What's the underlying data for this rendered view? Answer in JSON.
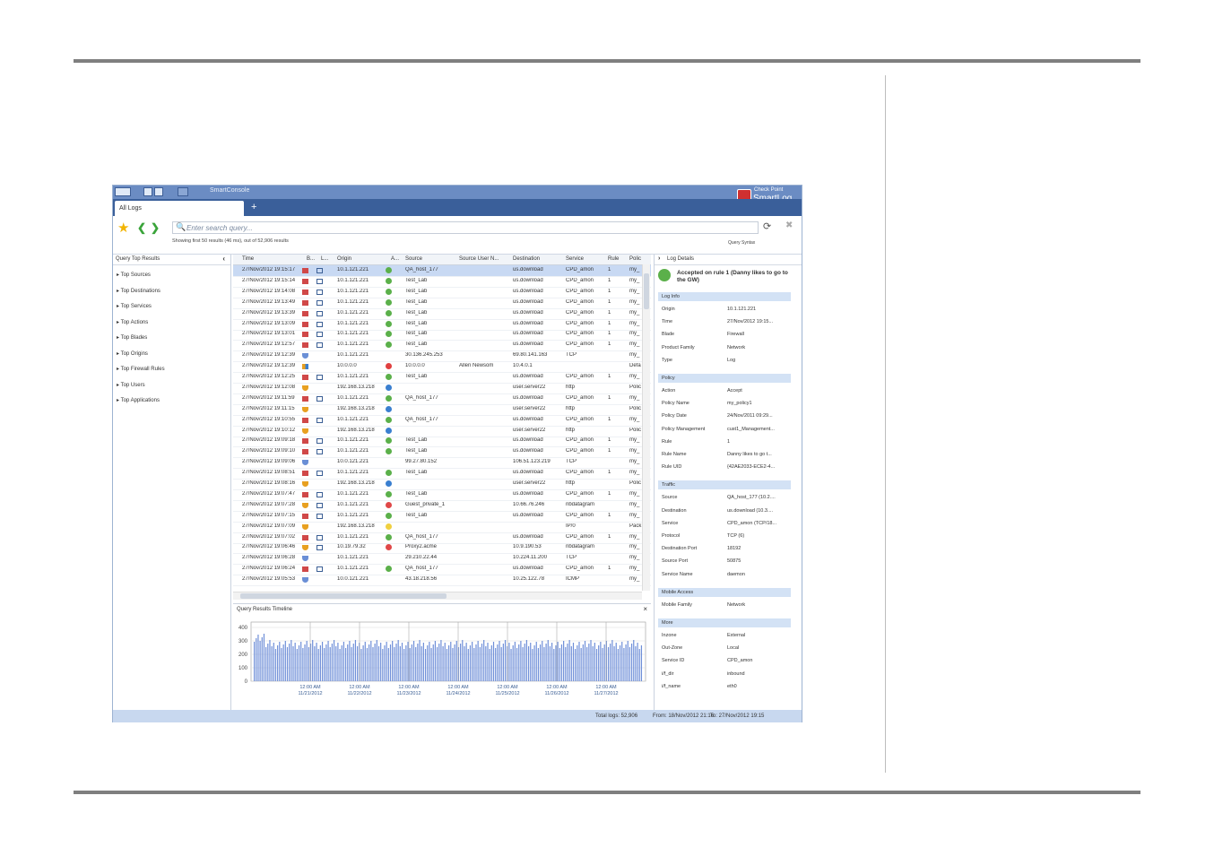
{
  "window": {
    "title_menu": "SmartConsole",
    "brand_line1": "Check Point",
    "brand_line2": "SmartLog"
  },
  "tabs": [
    {
      "label": "All Logs"
    }
  ],
  "tab_add": "+",
  "search": {
    "placeholder": "Enter search query...",
    "showing": "Showing first 50 results (46 ms), out of 52,906 results",
    "syntax": "Query Syntax"
  },
  "left_panel": {
    "title": "Query Top Results",
    "items": [
      "Top Sources",
      "Top Destinations",
      "Top Services",
      "Top Actions",
      "Top Blades",
      "Top Origins",
      "Top Firewall Rules",
      "Top Users",
      "Top Applications"
    ]
  },
  "grid": {
    "columns": [
      "Time",
      "B...",
      "L...",
      "Origin",
      "A...",
      "Source",
      "Source User N...",
      "Destination",
      "Service",
      "Rule",
      "Polic"
    ],
    "rows": [
      {
        "time": "27/Nov/2012 19:15:17",
        "blade": "fw",
        "origin": "10.1.121.221",
        "action": "accept",
        "source": "QA_host_177",
        "user": "",
        "dest": "us.download",
        "service": "CPD_amon",
        "rule": "1",
        "policy": "my_"
      },
      {
        "time": "27/Nov/2012 19:15:14",
        "blade": "fw",
        "origin": "10.1.121.221",
        "action": "accept",
        "source": "Test_Lab",
        "user": "",
        "dest": "us.download",
        "service": "CPD_amon",
        "rule": "1",
        "policy": "my_"
      },
      {
        "time": "27/Nov/2012 19:14:08",
        "blade": "fw",
        "origin": "10.1.121.221",
        "action": "accept",
        "source": "Test_Lab",
        "user": "",
        "dest": "us.download",
        "service": "CPD_amon",
        "rule": "1",
        "policy": "my_"
      },
      {
        "time": "27/Nov/2012 19:13:49",
        "blade": "fw",
        "origin": "10.1.121.221",
        "action": "accept",
        "source": "Test_Lab",
        "user": "",
        "dest": "us.download",
        "service": "CPD_amon",
        "rule": "1",
        "policy": "my_"
      },
      {
        "time": "27/Nov/2012 19:13:39",
        "blade": "fw",
        "origin": "10.1.121.221",
        "action": "accept",
        "source": "Test_Lab",
        "user": "",
        "dest": "us.download",
        "service": "CPD_amon",
        "rule": "1",
        "policy": "my_"
      },
      {
        "time": "27/Nov/2012 19:13:09",
        "blade": "fw",
        "origin": "10.1.121.221",
        "action": "accept",
        "source": "Test_Lab",
        "user": "",
        "dest": "us.download",
        "service": "CPD_amon",
        "rule": "1",
        "policy": "my_"
      },
      {
        "time": "27/Nov/2012 19:13:01",
        "blade": "fw",
        "origin": "10.1.121.221",
        "action": "accept",
        "source": "Test_Lab",
        "user": "",
        "dest": "us.download",
        "service": "CPD_amon",
        "rule": "1",
        "policy": "my_"
      },
      {
        "time": "27/Nov/2012 19:12:57",
        "blade": "fw",
        "origin": "10.1.121.221",
        "action": "accept",
        "source": "Test_Lab",
        "user": "",
        "dest": "us.download",
        "service": "CPD_amon",
        "rule": "1",
        "policy": "my_"
      },
      {
        "time": "27/Nov/2012 19:12:39",
        "blade": "ips",
        "origin": "10.1.121.221",
        "action": "",
        "source": "30.136.245.253",
        "user": "",
        "dest": "69.80.141.163",
        "service": "TCP",
        "rule": "",
        "policy": "my_"
      },
      {
        "time": "27/Nov/2012 19:12:39",
        "blade": "multi",
        "origin": "10.0.0.0",
        "action": "drop",
        "source": "10.0.0.0",
        "user": "Allen Newsom",
        "dest": "10.4.0.1",
        "service": "",
        "rule": "",
        "policy": "Defa"
      },
      {
        "time": "27/Nov/2012 19:12:25",
        "blade": "fw",
        "origin": "10.1.121.221",
        "action": "accept",
        "source": "Test_Lab",
        "user": "",
        "dest": "us.download",
        "service": "CPD_amon",
        "rule": "1",
        "policy": "my_"
      },
      {
        "time": "27/Nov/2012 19:12:08",
        "blade": "av",
        "origin": "192.168.13.218",
        "action": "shield",
        "source": "",
        "user": "",
        "dest": "user.server22",
        "service": "http",
        "rule": "",
        "policy": "Polic"
      },
      {
        "time": "27/Nov/2012 19:11:59",
        "blade": "fw",
        "origin": "10.1.121.221",
        "action": "accept",
        "source": "QA_host_177",
        "user": "",
        "dest": "us.download",
        "service": "CPD_amon",
        "rule": "1",
        "policy": "my_"
      },
      {
        "time": "27/Nov/2012 19:11:15",
        "blade": "av",
        "origin": "192.168.13.218",
        "action": "shield",
        "source": "",
        "user": "",
        "dest": "user.server22",
        "service": "http",
        "rule": "",
        "policy": "Polic"
      },
      {
        "time": "27/Nov/2012 19:10:55",
        "blade": "fw",
        "origin": "10.1.121.221",
        "action": "accept",
        "source": "QA_host_177",
        "user": "",
        "dest": "us.download",
        "service": "CPD_amon",
        "rule": "1",
        "policy": "my_"
      },
      {
        "time": "27/Nov/2012 19:10:12",
        "blade": "av",
        "origin": "192.168.13.218",
        "action": "shield",
        "source": "",
        "user": "",
        "dest": "user.server22",
        "service": "http",
        "rule": "",
        "policy": "Polic"
      },
      {
        "time": "27/Nov/2012 19:09:18",
        "blade": "fw",
        "origin": "10.1.121.221",
        "action": "accept",
        "source": "Test_Lab",
        "user": "",
        "dest": "us.download",
        "service": "CPD_amon",
        "rule": "1",
        "policy": "my_"
      },
      {
        "time": "27/Nov/2012 19:09:10",
        "blade": "fw",
        "origin": "10.1.121.221",
        "action": "accept",
        "source": "Test_Lab",
        "user": "",
        "dest": "us.download",
        "service": "CPD_amon",
        "rule": "1",
        "policy": "my_"
      },
      {
        "time": "27/Nov/2012 19:09:06",
        "blade": "ips",
        "origin": "10.0.121.221",
        "action": "",
        "source": "99.27.80.152",
        "user": "",
        "dest": "106.51.123.219",
        "service": "TCP",
        "rule": "",
        "policy": "my_"
      },
      {
        "time": "27/Nov/2012 19:08:51",
        "blade": "fw",
        "origin": "10.1.121.221",
        "action": "accept",
        "source": "Test_Lab",
        "user": "",
        "dest": "us.download",
        "service": "CPD_amon",
        "rule": "1",
        "policy": "my_"
      },
      {
        "time": "27/Nov/2012 19:08:16",
        "blade": "av",
        "origin": "192.168.13.218",
        "action": "shield",
        "source": "",
        "user": "",
        "dest": "user.server22",
        "service": "http",
        "rule": "",
        "policy": "Polic"
      },
      {
        "time": "27/Nov/2012 19:07:47",
        "blade": "fw",
        "origin": "10.1.121.221",
        "action": "accept",
        "source": "Test_Lab",
        "user": "",
        "dest": "us.download",
        "service": "CPD_amon",
        "rule": "1",
        "policy": "my_"
      },
      {
        "time": "27/Nov/2012 19:07:28",
        "blade": "app",
        "origin": "10.1.121.221",
        "action": "block",
        "source": "Guest_private_1",
        "user": "",
        "dest": "10.66.76.246",
        "service": "nbdatagram",
        "rule": "",
        "policy": "my_"
      },
      {
        "time": "27/Nov/2012 19:07:15",
        "blade": "fw",
        "origin": "10.1.121.221",
        "action": "accept",
        "source": "Test_Lab",
        "user": "",
        "dest": "us.download",
        "service": "CPD_amon",
        "rule": "1",
        "policy": "my_"
      },
      {
        "time": "27/Nov/2012 19:07:09",
        "blade": "av",
        "origin": "192.168.13.218",
        "action": "detect",
        "source": "",
        "user": "",
        "dest": "",
        "service": "IP/0",
        "rule": "",
        "policy": "Pack"
      },
      {
        "time": "27/Nov/2012 19:07:02",
        "blade": "fw",
        "origin": "10.1.121.221",
        "action": "accept",
        "source": "QA_host_177",
        "user": "",
        "dest": "us.download",
        "service": "CPD_amon",
        "rule": "1",
        "policy": "my_"
      },
      {
        "time": "27/Nov/2012 19:06:46",
        "blade": "app",
        "origin": "10.19.79.32",
        "action": "block",
        "source": "Proxy2.acme",
        "user": "",
        "dest": "10.9.190.53",
        "service": "nbdatagram",
        "rule": "",
        "policy": "my_"
      },
      {
        "time": "27/Nov/2012 19:06:28",
        "blade": "ips",
        "origin": "10.1.121.221",
        "action": "",
        "source": "29.210.22.44",
        "user": "",
        "dest": "10.224.11.200",
        "service": "TCP",
        "rule": "",
        "policy": "my_"
      },
      {
        "time": "27/Nov/2012 19:06:24",
        "blade": "fw",
        "origin": "10.1.121.221",
        "action": "accept",
        "source": "QA_host_177",
        "user": "",
        "dest": "us.download",
        "service": "CPD_amon",
        "rule": "1",
        "policy": "my_"
      },
      {
        "time": "27/Nov/2012 19:05:53",
        "blade": "ips",
        "origin": "10.0.121.221",
        "action": "",
        "source": "43.18.218.56",
        "user": "",
        "dest": "10.25.122.78",
        "service": "ICMP",
        "rule": "",
        "policy": "my_"
      }
    ]
  },
  "timeline": {
    "title": "Query Results Timeline",
    "close": "×",
    "yticks": [
      "400",
      "300",
      "200",
      "100",
      "0"
    ],
    "xticks": [
      {
        "t": "12:00 AM",
        "d": "11/21/2012"
      },
      {
        "t": "12:00 AM",
        "d": "11/22/2012"
      },
      {
        "t": "12:00 AM",
        "d": "11/23/2012"
      },
      {
        "t": "12:00 AM",
        "d": "11/24/2012"
      },
      {
        "t": "12:00 AM",
        "d": "11/25/2012"
      },
      {
        "t": "12:00 AM",
        "d": "11/26/2012"
      },
      {
        "t": "12:00 AM",
        "d": "11/27/2012"
      }
    ]
  },
  "details": {
    "title": "Log Details",
    "headline": "Accepted on rule 1 (Danny likes to go to the GW)",
    "sections": [
      {
        "name": "Log Info",
        "rows": [
          [
            "Origin",
            "10.1.121.221"
          ],
          [
            "Time",
            "27/Nov/2012 19:15..."
          ],
          [
            "Blade",
            "Firewall"
          ],
          [
            "Product Family",
            "Network"
          ],
          [
            "Type",
            "Log"
          ]
        ]
      },
      {
        "name": "Policy",
        "rows": [
          [
            "Action",
            "Accept"
          ],
          [
            "Policy Name",
            "my_policy1"
          ],
          [
            "Policy Date",
            "24/Nov/2011 09:29..."
          ],
          [
            "Policy Management",
            "cust1_Management..."
          ],
          [
            "Rule",
            "1"
          ],
          [
            "Rule Name",
            "Danny likes to go t..."
          ],
          [
            "Rule UID",
            "{42AE2033-ECE2-4..."
          ]
        ]
      },
      {
        "name": "Traffic",
        "rows": [
          [
            "Source",
            "QA_host_177 (10.2...."
          ],
          [
            "Destination",
            "us.download (10.3...."
          ],
          [
            "Service",
            "CPD_amon (TCP/18..."
          ],
          [
            "Protocol",
            "TCP (6)"
          ],
          [
            "Destination Port",
            "18192"
          ],
          [
            "Source Port",
            "50875"
          ],
          [
            "Service Name",
            "daemon"
          ]
        ]
      },
      {
        "name": "Mobile Access",
        "rows": [
          [
            "Mobile Family",
            "Network"
          ]
        ]
      },
      {
        "name": "More",
        "rows": [
          [
            "Inzone",
            "External"
          ],
          [
            "Out-Zone",
            "Local"
          ],
          [
            "Service ID",
            "CPD_amon"
          ],
          [
            "i/f_dir",
            "inbound"
          ],
          [
            "i/f_name",
            "eth0"
          ]
        ]
      }
    ]
  },
  "status": {
    "total": "Total logs: 52,906",
    "from": "From: 18/Nov/2012 21:16",
    "to": "To: 27/Nov/2012 19:15"
  },
  "colors": {
    "accent": "#6b8cc3",
    "tabbar": "#3a5f9a",
    "firewall": "#d04848",
    "accept": "#5bb04a",
    "drop": "#e04040",
    "shield": "#3a7fd0"
  }
}
